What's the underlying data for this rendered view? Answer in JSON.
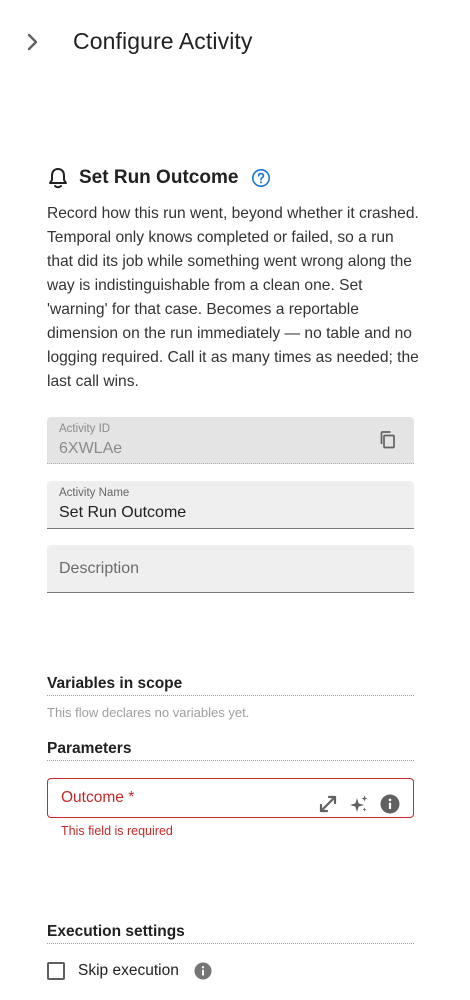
{
  "header": {
    "title": "Configure Activity",
    "expand_icon": "chevron-right-icon"
  },
  "activity": {
    "icon": "bell-icon",
    "title": "Set Run Outcome",
    "help_icon": "help-circle-icon",
    "description": "Record how this run went, beyond whether it crashed. Temporal only knows completed or failed, so a run that did its job while something went wrong along the way is indistinguishable from a clean one. Set 'warning' for that case. Becomes a reportable dimension on the run immediately — no table and no logging required. Call it as many times as needed; the last call wins."
  },
  "fields": {
    "activity_id": {
      "label": "Activity ID",
      "value": "6XWLAe",
      "disabled": true,
      "action_icon": "copy-icon"
    },
    "activity_name": {
      "label": "Activity Name",
      "value": "Set Run Outcome"
    },
    "description": {
      "placeholder": "Description",
      "value": ""
    }
  },
  "variables": {
    "heading": "Variables in scope",
    "empty_text": "This flow declares no variables yet."
  },
  "parameters": {
    "heading": "Parameters",
    "outcome": {
      "label": "Outcome *",
      "error": "This field is required",
      "icons": [
        "expand-icon",
        "sparkle-icon",
        "info-icon"
      ]
    }
  },
  "execution": {
    "heading": "Execution settings",
    "skip_label": "Skip execution",
    "skip_checked": false,
    "info_icon": "info-icon"
  },
  "colors": {
    "accent": "#1976d2",
    "error": "#c62828",
    "text": "#212121",
    "muted": "#9e9e9e"
  }
}
